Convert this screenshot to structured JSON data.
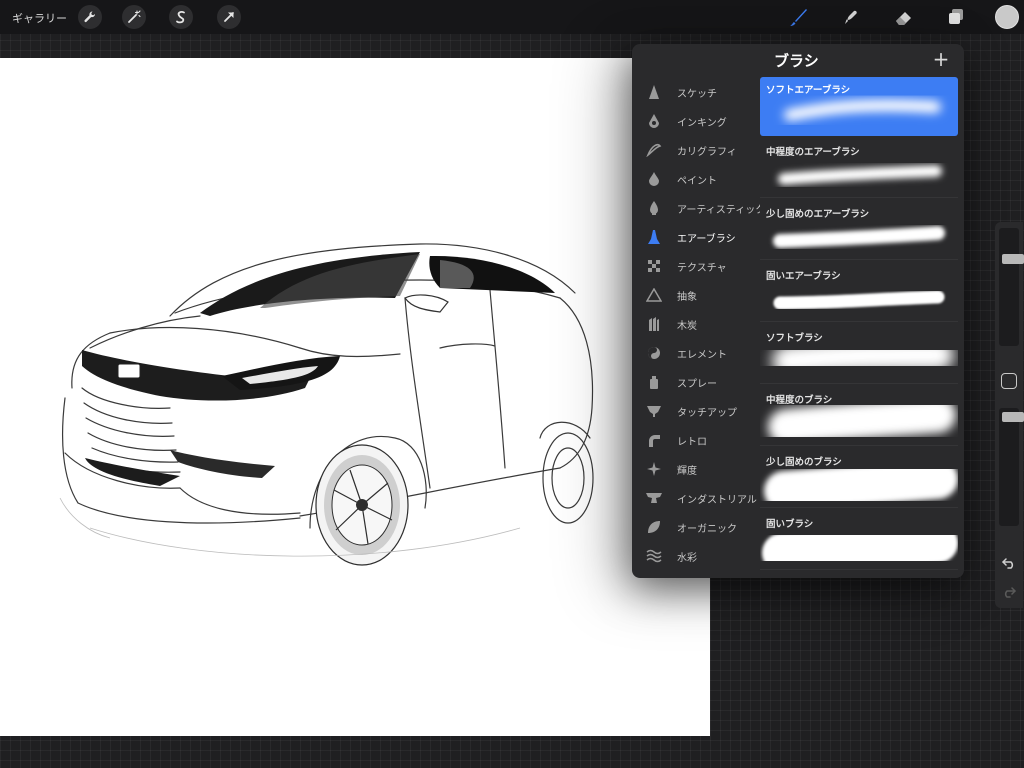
{
  "topbar": {
    "gallery_label": "ギャラリー",
    "tools_left": [
      "wrench-icon",
      "magic-wand-icon",
      "selection-icon",
      "transform-arrow-icon"
    ],
    "tools_right": [
      "brush-icon",
      "smudge-icon",
      "eraser-icon",
      "layers-icon"
    ],
    "accent_color": "#3d7df3",
    "current_color": "#c9c9c9"
  },
  "panel": {
    "title": "ブラシ",
    "add_label": "+",
    "categories": [
      {
        "label": "スケッチ",
        "icon": "pencil-tip-icon"
      },
      {
        "label": "インキング",
        "icon": "ink-drop-icon"
      },
      {
        "label": "カリグラフィ",
        "icon": "calligraphy-icon"
      },
      {
        "label": "ペイント",
        "icon": "paint-drop-icon"
      },
      {
        "label": "アーティスティック",
        "icon": "artistic-icon"
      },
      {
        "label": "エアーブラシ",
        "icon": "airbrush-icon",
        "active": true
      },
      {
        "label": "テクスチャ",
        "icon": "texture-icon"
      },
      {
        "label": "抽象",
        "icon": "abstract-triangle-icon"
      },
      {
        "label": "木炭",
        "icon": "charcoal-icon"
      },
      {
        "label": "エレメント",
        "icon": "element-yinyang-icon"
      },
      {
        "label": "スプレー",
        "icon": "spray-can-icon"
      },
      {
        "label": "タッチアップ",
        "icon": "touchup-icon"
      },
      {
        "label": "レトロ",
        "icon": "retro-icon"
      },
      {
        "label": "輝度",
        "icon": "luminance-sparkle-icon"
      },
      {
        "label": "インダストリアル",
        "icon": "anvil-icon"
      },
      {
        "label": "オーガニック",
        "icon": "leaf-icon"
      },
      {
        "label": "水彩",
        "icon": "water-waves-icon"
      }
    ],
    "brushes": [
      {
        "name": "ソフトエアーブラシ",
        "active": true
      },
      {
        "name": "中程度のエアーブラシ"
      },
      {
        "name": "少し固めのエアーブラシ"
      },
      {
        "name": "固いエアーブラシ"
      },
      {
        "name": "ソフトブラシ"
      },
      {
        "name": "中程度のブラシ"
      },
      {
        "name": "少し固めのブラシ"
      },
      {
        "name": "固いブラシ"
      }
    ]
  },
  "sidebar": {
    "size_slider": 0.76,
    "opacity_slider": 0.96,
    "undo_icon": "undo-icon",
    "redo_icon": "redo-icon"
  }
}
